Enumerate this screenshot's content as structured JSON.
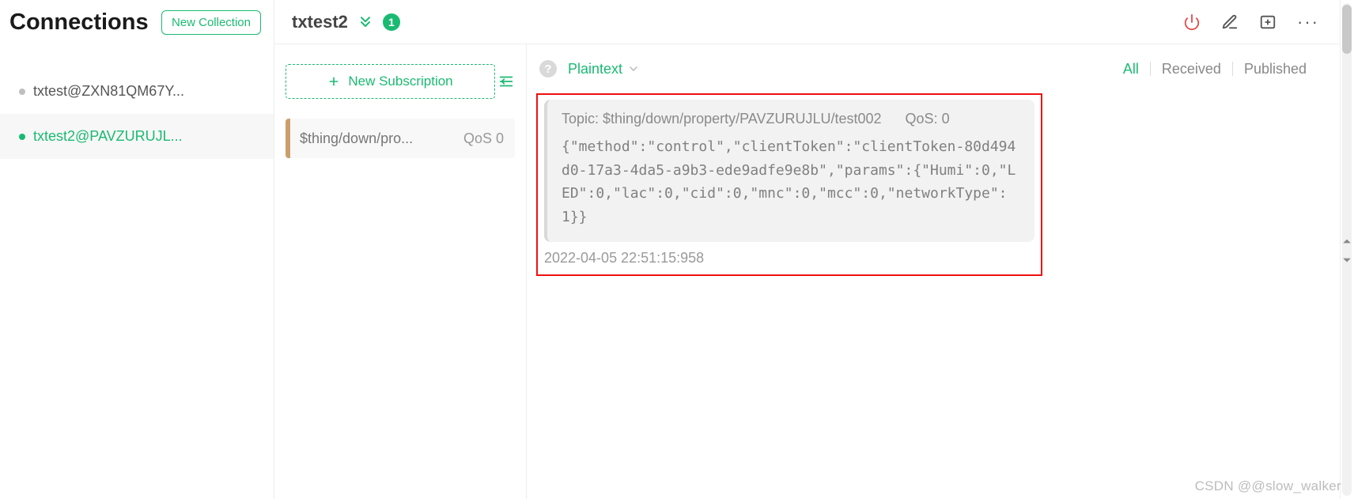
{
  "sidebar": {
    "title": "Connections",
    "new_collection_label": "New Collection",
    "items": [
      {
        "label": "txtest@ZXN81QM67Y...",
        "active": false
      },
      {
        "label": "txtest2@PAVZURUJL...",
        "active": true
      }
    ]
  },
  "header": {
    "connection_name": "txtest2",
    "badge_count": "1",
    "icons": {
      "expand": "chevron-double-down-icon",
      "power": "power-icon",
      "edit": "edit-icon",
      "new_window": "new-window-icon",
      "more": "···"
    }
  },
  "subscriptions": {
    "new_label": "New Subscription",
    "collapse_icon": "collapse-left-icon",
    "items": [
      {
        "topic": "$thing/down/pro...",
        "qos_label": "QoS 0",
        "color": "#caa06a"
      }
    ]
  },
  "messages": {
    "help_glyph": "?",
    "format_label": "Plaintext",
    "filters": {
      "all": "All",
      "received": "Received",
      "published": "Published",
      "active": "all"
    },
    "items": [
      {
        "topic_prefix": "Topic: ",
        "topic": "$thing/down/property/PAVZURUJLU/test002",
        "qos_prefix": "QoS: ",
        "qos": "0",
        "payload": "{\"method\":\"control\",\"clientToken\":\"clientToken-80d494d0-17a3-4da5-a9b3-ede9adfe9e8b\",\"params\":{\"Humi\":0,\"LED\":0,\"lac\":0,\"cid\":0,\"mnc\":0,\"mcc\":0,\"networkType\":1}}",
        "timestamp": "2022-04-05 22:51:15:958"
      }
    ]
  },
  "watermark": "CSDN @@slow_walker"
}
